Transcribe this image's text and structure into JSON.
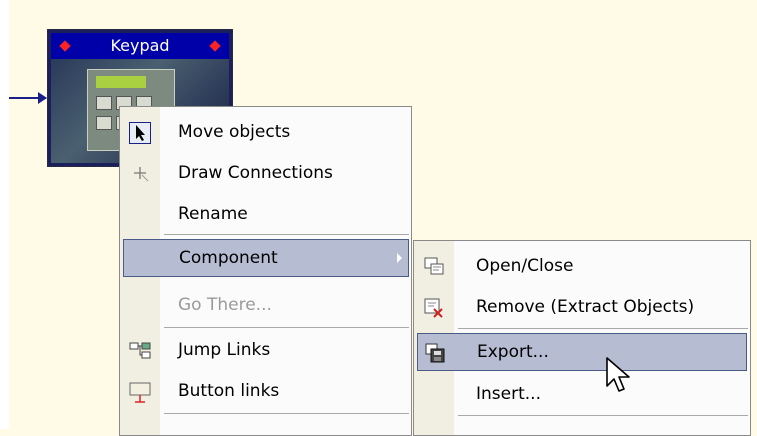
{
  "canvas": {
    "node": {
      "title": "Keypad"
    }
  },
  "context_menu": {
    "items": [
      {
        "label": "Move objects",
        "icon": "arrow-pointer-icon"
      },
      {
        "label": "Draw Connections",
        "icon": "crosshair-icon"
      },
      {
        "label": "Rename",
        "icon": ""
      },
      {
        "label": "Component",
        "icon": "",
        "highlighted": true,
        "has_submenu": true
      },
      {
        "label": "Go There...",
        "icon": "",
        "disabled": true
      },
      {
        "label": "Jump Links",
        "icon": "jump-links-icon"
      },
      {
        "label": "Button links",
        "icon": "button-links-icon"
      }
    ]
  },
  "submenu": {
    "items": [
      {
        "label": "Open/Close",
        "icon": "open-close-icon"
      },
      {
        "label": "Remove (Extract Objects)",
        "icon": "remove-extract-icon"
      },
      {
        "label": "Export...",
        "icon": "export-icon",
        "highlighted": true
      },
      {
        "label": "Insert...",
        "icon": ""
      }
    ]
  },
  "colors": {
    "canvas_bg": "#fffbe6",
    "highlight": "#b6bdd2",
    "highlight_border": "#4b5a86",
    "node_header": "#0000a8",
    "wire": "#1a1f8c"
  }
}
